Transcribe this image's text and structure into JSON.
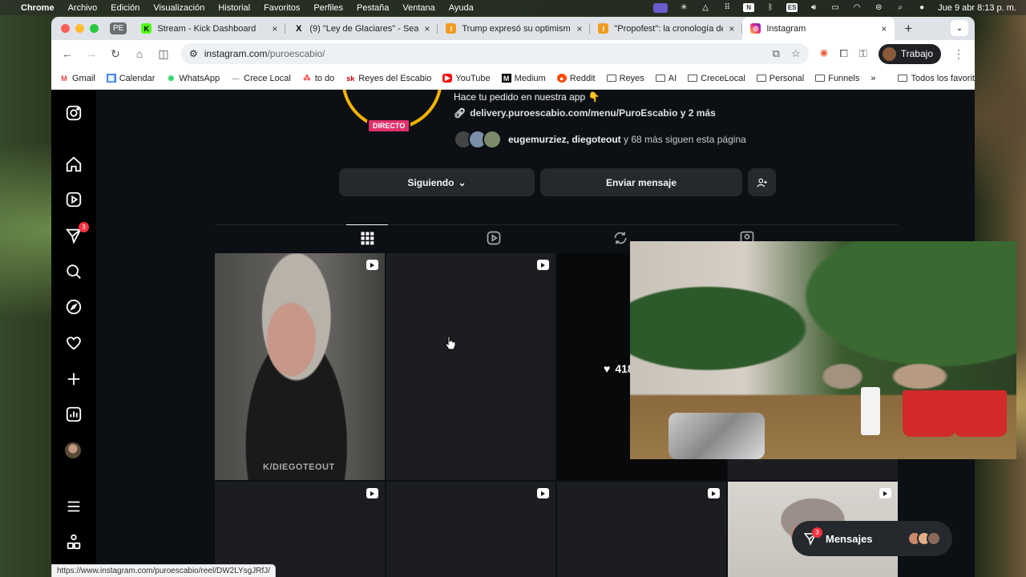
{
  "menubar": {
    "app": "Chrome",
    "items": [
      "Archivo",
      "Edición",
      "Visualización",
      "Historial",
      "Favoritos",
      "Perfiles",
      "Pestaña",
      "Ventana",
      "Ayuda"
    ],
    "input_source": "ES",
    "clock": "Jue 9 abr  8:13 p. m."
  },
  "tabs": {
    "group_label": "PE",
    "items": [
      {
        "title": "Stream - Kick Dashboard",
        "fav_color": "#53fc18",
        "fav_text": "K"
      },
      {
        "title": "(9) \"Ley de Glaciares\" - Searc",
        "fav_color": "#000000",
        "fav_text": "X"
      },
      {
        "title": "Trump expresó su optimismo",
        "fav_color": "#f29a1f",
        "fav_text": "I"
      },
      {
        "title": "\"Propofest\": la cronología de",
        "fav_color": "#f29a1f",
        "fav_text": "I"
      },
      {
        "title": "Instagram",
        "fav_color": "#d6249f",
        "fav_text": "◎"
      }
    ]
  },
  "address": {
    "host": "instagram.com",
    "path": "/puroescabio/"
  },
  "profile_button": "Trabajo",
  "bookmarks": [
    {
      "label": "Gmail",
      "icon": "gmail-icon"
    },
    {
      "label": "Calendar",
      "icon": "calendar-icon"
    },
    {
      "label": "WhatsApp",
      "icon": "whatsapp-icon"
    },
    {
      "label": "Crece Local",
      "icon": "dash-icon"
    },
    {
      "label": "to do",
      "icon": "todo-icon"
    },
    {
      "label": "Reyes del Escabio",
      "icon": "sk-icon"
    },
    {
      "label": "YouTube",
      "icon": "youtube-icon"
    },
    {
      "label": "Medium",
      "icon": "medium-icon"
    },
    {
      "label": "Reddit",
      "icon": "reddit-icon"
    },
    {
      "label": "Reyes",
      "icon": "folder-icon"
    },
    {
      "label": "AI",
      "icon": "folder-icon"
    },
    {
      "label": "CreceLocal",
      "icon": "folder-icon"
    },
    {
      "label": "Personal",
      "icon": "folder-icon"
    },
    {
      "label": "Funnels",
      "icon": "folder-icon"
    }
  ],
  "bookmarks_more": "»",
  "bookmarks_all": "Todos los favoritos",
  "profile": {
    "live_label": "DIRECTO",
    "bio": "Hace tu pedido en nuestra app 👇",
    "link": "delivery.puroescabio.com/menu/PuroEscabio y 2 más",
    "followers_names": "eugemurziez, diegoteout",
    "followers_rest": " y 68 más siguen esta página"
  },
  "buttons": {
    "follow": "Siguiendo",
    "message": "Enviar mensaje"
  },
  "grid": {
    "watermark": "K/DIEGOTEOUT",
    "likes": "418"
  },
  "nav_badge": "3",
  "messages": {
    "label": "Mensajes",
    "badge": "3"
  },
  "status_url": "https://www.instagram.com/puroescabio/reel/DW2LYsgJRfJ/"
}
